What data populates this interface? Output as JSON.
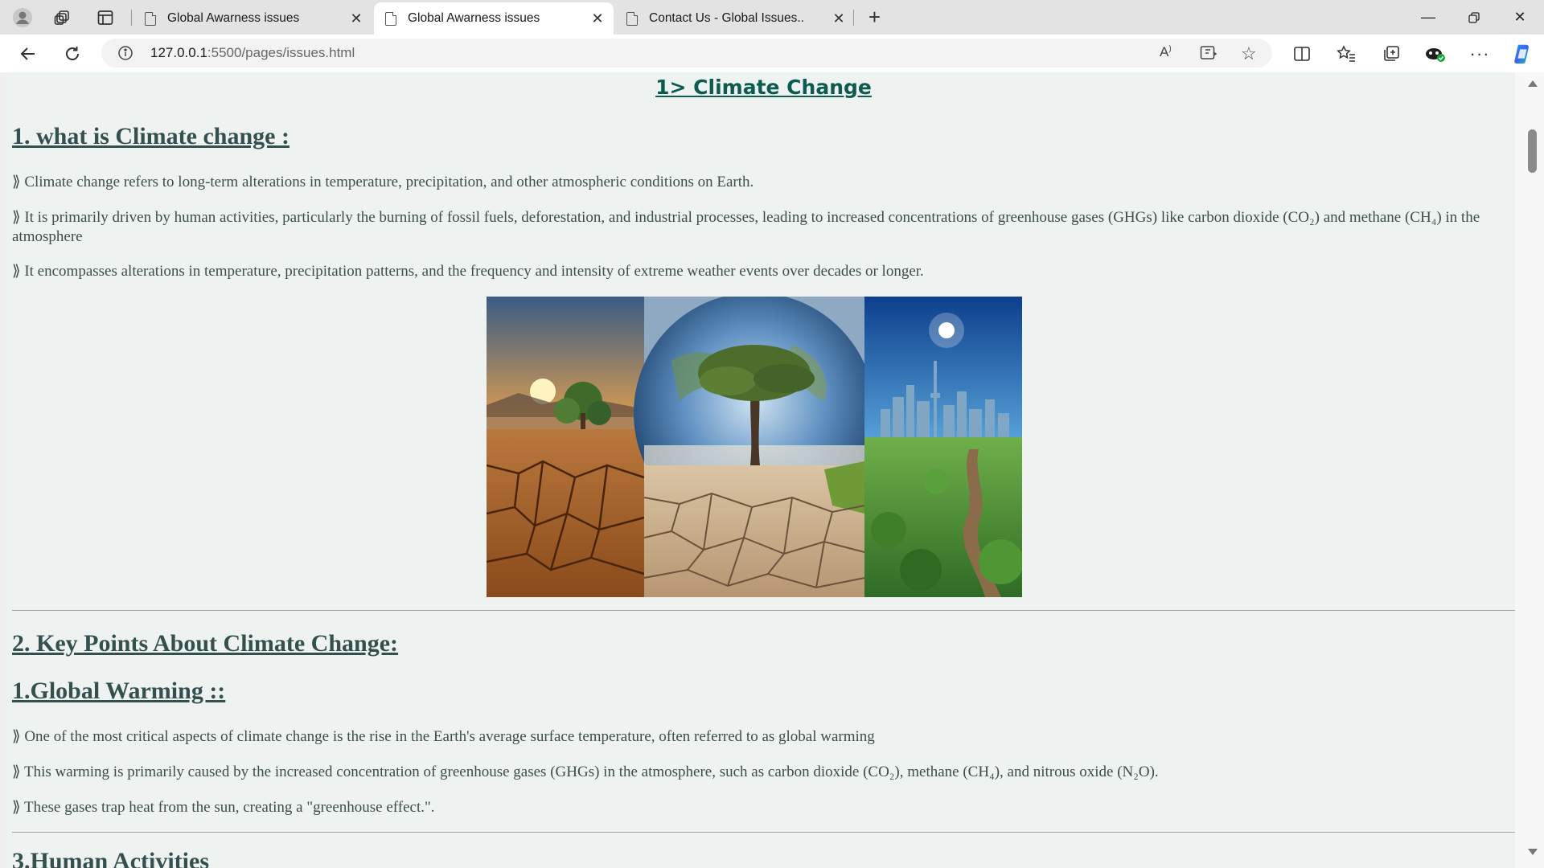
{
  "browser": {
    "tabs": [
      {
        "title": "Global Awarness issues",
        "active": false
      },
      {
        "title": "Global Awarness issues",
        "active": true
      },
      {
        "title": "Contact Us - Global Issues..",
        "active": false
      }
    ],
    "url_host": "127.0.0.1",
    "url_path": ":5500/pages/issues.html"
  },
  "page": {
    "section_title": "1> Climate Change",
    "what_heading": "1. what is Climate change :",
    "what_points": [
      "⟫ Climate change refers to long-term alterations in temperature, precipitation, and other atmospheric conditions on Earth.",
      "⟫ It is primarily driven by human activities, particularly the burning of fossil fuels, deforestation, and industrial processes, leading to increased concentrations of greenhouse gases (GHGs) like carbon dioxide (CO₂) and methane (CH₄) in the atmosphere",
      "⟫ It encompasses alterations in temperature, precipitation patterns, and the frequency and intensity of extreme weather events over decades or longer."
    ],
    "key_heading": "2. Key Points About Climate Change:",
    "warming_heading": "1.Global Warming ::",
    "warming_points": [
      "⟫ One of the most critical aspects of climate change is the rise in the Earth's average surface temperature, often referred to as global warming",
      "⟫ This warming is primarily caused by the increased concentration of greenhouse gases (GHGs) in the atmosphere, such as carbon dioxide (CO₂), methane (CH₄), and nitrous oxide (N₂O).",
      "⟫ These gases trap heat from the sun, creating a \"greenhouse effect.\"."
    ],
    "next_heading_partial": "3.Human Activities"
  },
  "colors": {
    "page_bg": "#eef3f2",
    "heading": "#33504e",
    "title_accent": "#0d5a4e",
    "body_text": "#3d4d4b"
  }
}
